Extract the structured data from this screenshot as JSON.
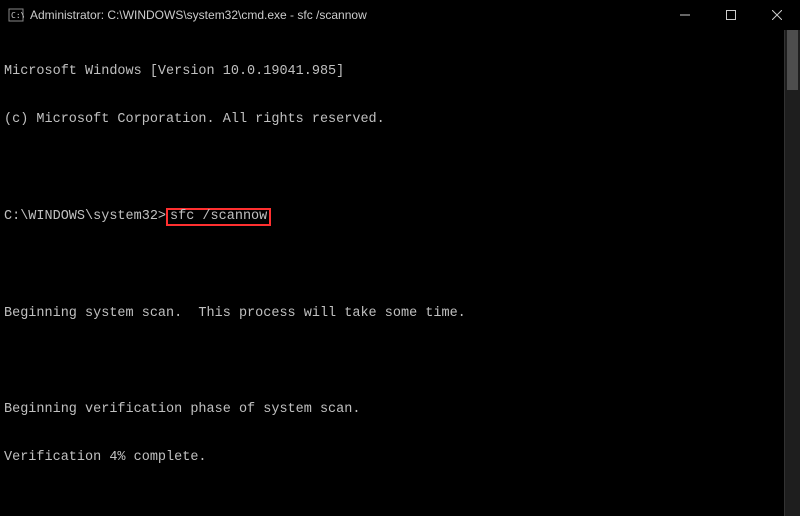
{
  "titlebar": {
    "title": "Administrator: C:\\WINDOWS\\system32\\cmd.exe - sfc  /scannow"
  },
  "terminal": {
    "version_line": "Microsoft Windows [Version 10.0.19041.985]",
    "copyright_line": "(c) Microsoft Corporation. All rights reserved.",
    "prompt_path": "C:\\WINDOWS\\system32>",
    "command": "sfc /scannow",
    "scan_begin": "Beginning system scan.  This process will take some time.",
    "verify_begin": "Beginning verification phase of system scan.",
    "verify_progress": "Verification 4% complete."
  }
}
